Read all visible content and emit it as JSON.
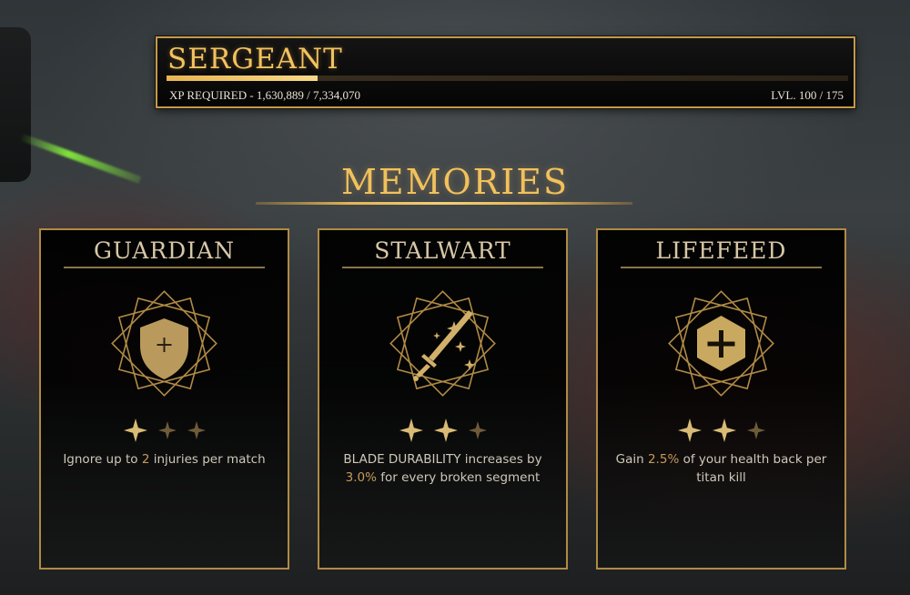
{
  "rank": {
    "title": "SERGEANT",
    "xp_label": "XP REQUIRED - 1,630,889 / 7,334,070",
    "xp_current": 1630889,
    "xp_required": 7334070,
    "xp_progress": 0.222,
    "level_label": "LVL. 100 / 175"
  },
  "section": {
    "title": "MEMORIES"
  },
  "colors": {
    "gold": "#f1c15c",
    "border": "#c59a48",
    "highlight": "#c69a5a"
  },
  "memories": [
    {
      "title": "GUARDIAN",
      "icon": "shield-plus-icon",
      "stars_filled": 1,
      "stars_total": 3,
      "desc_pre": "Ignore up to ",
      "desc_value": "2",
      "desc_post": " injuries per match"
    },
    {
      "title": "STALWART",
      "icon": "blade-sparkle-icon",
      "stars_filled": 2,
      "stars_total": 3,
      "desc_pre": "BLADE DURABILITY increases by ",
      "desc_value": "3.0%",
      "desc_post": " for every broken segment"
    },
    {
      "title": "LIFEFEED",
      "icon": "hexagon-plus-icon",
      "stars_filled": 2,
      "stars_total": 3,
      "desc_pre": "Gain ",
      "desc_value": "2.5%",
      "desc_post": " of your health back per titan kill"
    }
  ]
}
